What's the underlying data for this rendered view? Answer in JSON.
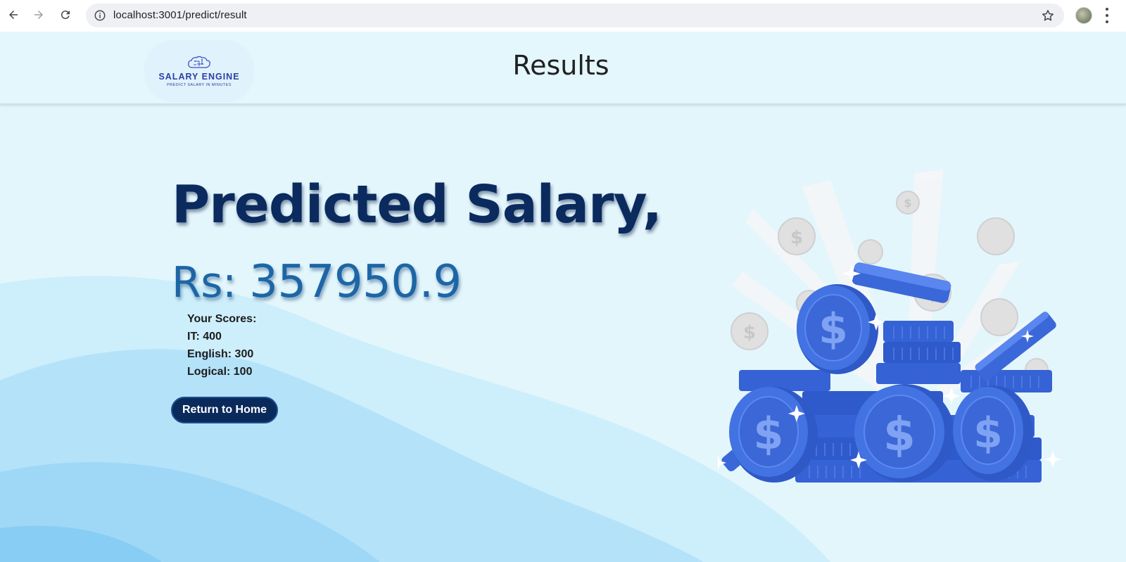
{
  "browser": {
    "url": "localhost:3001/predict/result",
    "back_icon": "arrow-left-icon",
    "forward_icon": "arrow-right-icon",
    "reload_icon": "reload-icon",
    "info_icon": "info-icon",
    "bookmark_icon": "star-icon",
    "menu_icon": "more-vert-icon"
  },
  "header": {
    "logo_title": "SALARY ENGINE",
    "logo_subtitle": "PREDICT SALARY IN MINUTES",
    "title": "Results"
  },
  "result": {
    "headline": "Predicted Salary,",
    "currency_prefix": "Rs: ",
    "salary_value": "357950.9"
  },
  "scores": {
    "heading": "Your Scores:",
    "it": "IT: 400",
    "english": "English: 300",
    "logical": "Logical: 100"
  },
  "actions": {
    "return_label": "Return to Home"
  },
  "colors": {
    "background": "#e3f6fc",
    "headline": "#0b2a5e",
    "salary": "#1d66a6",
    "button": "#0a2a5b",
    "wave_light": "#c6ebfb",
    "wave_mid": "#a8dcf7",
    "coin": "#3d6ee0"
  }
}
